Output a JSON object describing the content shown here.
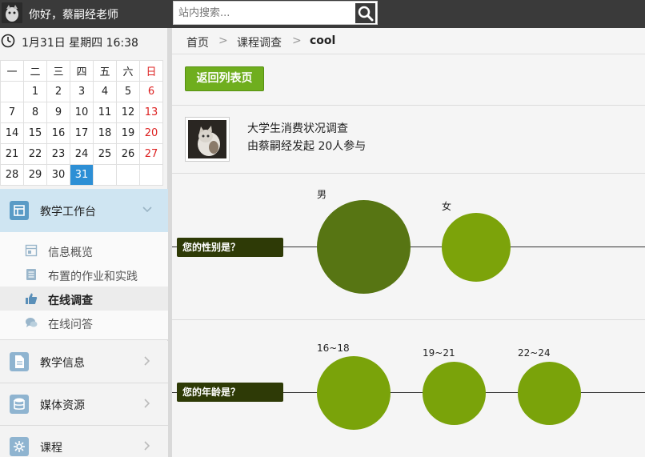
{
  "header": {
    "greeting": "你好，蔡嗣经老师",
    "search_placeholder": "站内搜索...",
    "avatar_icon": "user-avatar",
    "search_icon": "search-icon"
  },
  "datetime": "1月31日 星期四 16:38",
  "calendar": {
    "weekdays": [
      "一",
      "二",
      "三",
      "四",
      "五",
      "六",
      "日"
    ],
    "weeks": [
      [
        "",
        "1",
        "2",
        "3",
        "4",
        "5",
        "6"
      ],
      [
        "7",
        "8",
        "9",
        "10",
        "11",
        "12",
        "13"
      ],
      [
        "14",
        "15",
        "16",
        "17",
        "18",
        "19",
        "20"
      ],
      [
        "21",
        "22",
        "23",
        "24",
        "25",
        "26",
        "27"
      ],
      [
        "28",
        "29",
        "30",
        "31",
        "",
        "",
        ""
      ]
    ],
    "today": "31",
    "weekend_color": "#dd2222",
    "today_color": "#2d8fd5"
  },
  "sidebar": {
    "main": {
      "label": "教学工作台",
      "icon": "workbench-icon"
    },
    "sub_items": [
      {
        "label": "信息概览",
        "icon": "overview-icon"
      },
      {
        "label": "布置的作业和实践",
        "icon": "assignment-icon"
      },
      {
        "label": "在线调查",
        "icon": "thumbs-up-icon"
      },
      {
        "label": "在线问答",
        "icon": "chat-icon"
      }
    ],
    "active_sub": "在线调查",
    "sections": [
      {
        "label": "教学信息",
        "icon": "document-icon"
      },
      {
        "label": "媒体资源",
        "icon": "database-icon"
      },
      {
        "label": "课程",
        "icon": "gear-icon"
      }
    ]
  },
  "breadcrumb": {
    "home": "首页",
    "section": "课程调查",
    "current": "cool",
    "separator": ">"
  },
  "back_button": "返回列表页",
  "survey": {
    "title": "大学生消费状况调查",
    "meta": "由蔡嗣经发起 20人参与"
  },
  "questions": [
    {
      "label": "您的性别是？",
      "options": [
        {
          "label": "男",
          "color": "#577513"
        },
        {
          "label": "女",
          "color": "#7ca30a"
        }
      ]
    },
    {
      "label": "您的年龄是？",
      "options": [
        {
          "label": "16~18",
          "color": "#7aa30a"
        },
        {
          "label": "19~21",
          "color": "#7aa30a"
        },
        {
          "label": "22~24",
          "color": "#7aa30a"
        }
      ]
    }
  ],
  "colors": {
    "topbar": "#3a3a3a",
    "accent_green": "#6fae1e",
    "question_label_bg": "#2e3a06",
    "active_nav_bg": "#cfe5f2"
  }
}
